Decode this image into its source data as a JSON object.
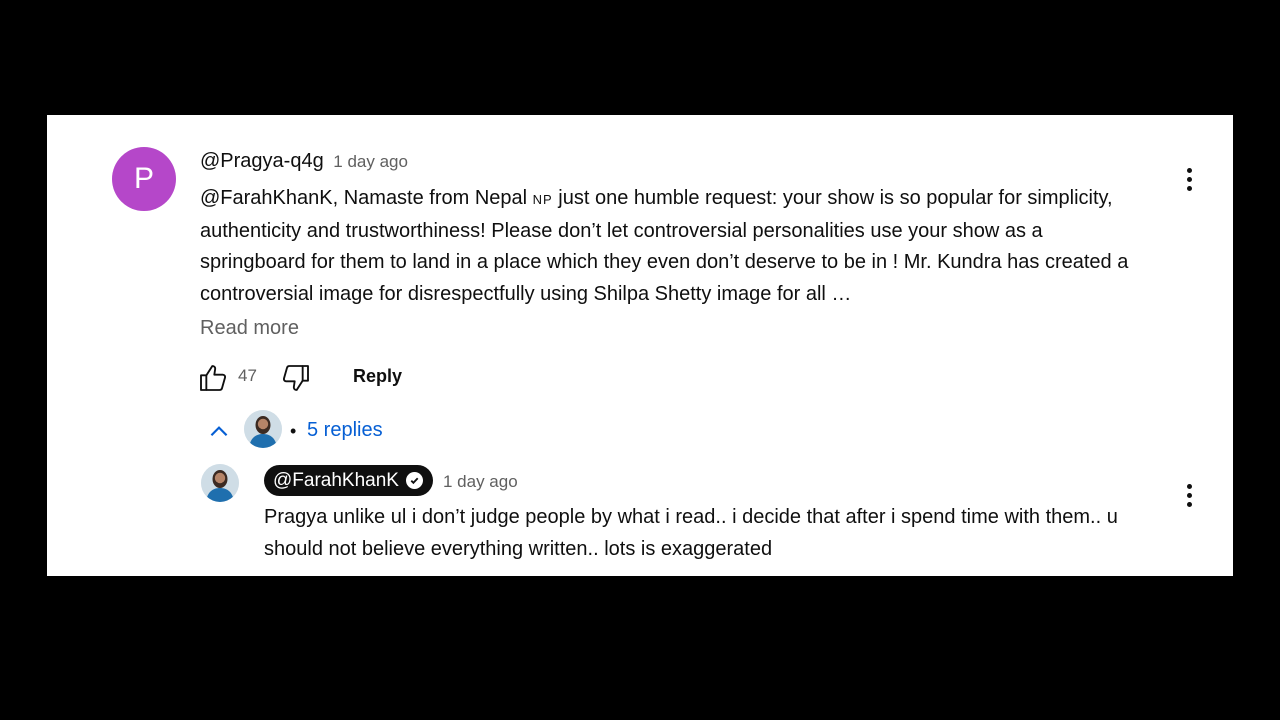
{
  "comment": {
    "avatar_letter": "P",
    "author": "@Pragya-q4g",
    "time": "1 day ago",
    "text_before_flag": "@FarahKhanK, Namaste from Nepal ",
    "flag_text": "NP",
    "text_after_flag": " just one humble request: your show is so popular for simplicity, authenticity and trustworthiness! Please don’t let controversial personalities use your show as a springboard for them to land in a place which they even don’t deserve to be in ! Mr. Kundra has created a controversial image for disrespectfully using Shilpa Shetty image for all …",
    "read_more": "Read more",
    "like_count": "47",
    "reply_label": "Reply"
  },
  "replies_toggle": {
    "separator": "•",
    "label": "5 replies"
  },
  "reply": {
    "author": "@FarahKhanK",
    "time": "1 day ago",
    "text": "Pragya unlike ul i don’t judge people by what i read.. i decide that after i spend time with them.. u should not believe everything written.. lots is exaggerated"
  },
  "icons": {
    "like": "thumbs-up-icon",
    "dislike": "thumbs-down-icon",
    "menu": "more-vert-icon",
    "collapse": "chevron-up-icon",
    "verified": "verified-check-icon"
  },
  "colors": {
    "avatar_bg": "#b547c9",
    "link": "#065fd4",
    "secondary_text": "#606060"
  }
}
